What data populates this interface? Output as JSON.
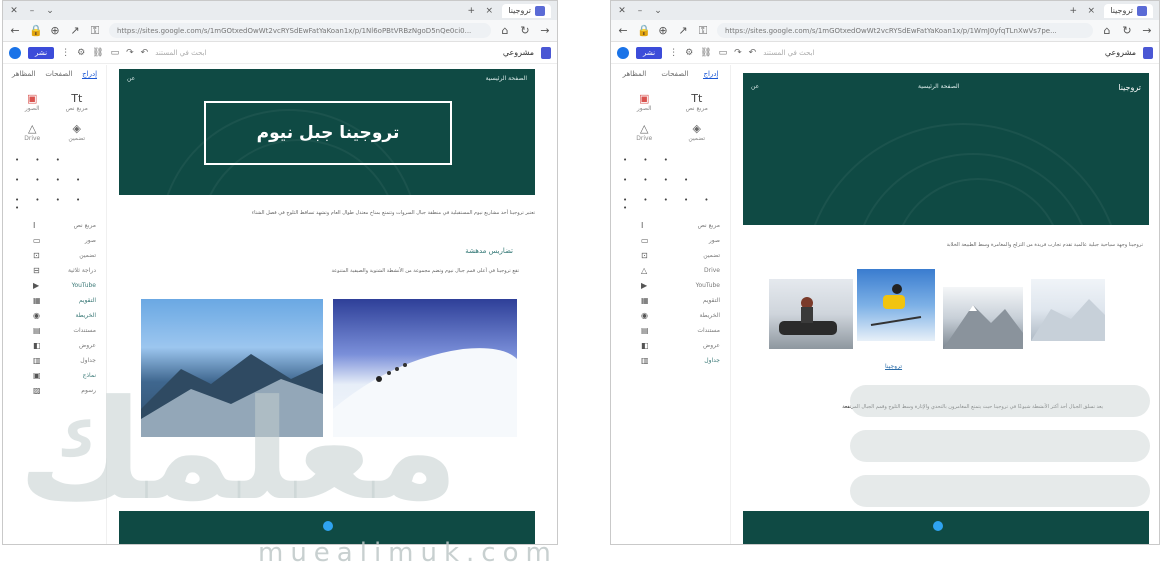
{
  "browser": {
    "tab_title": "تروجينا",
    "close_glyph": "×",
    "new_tab_glyph": "+",
    "url_host": "sites.google.com",
    "url_path_left": "https://sites.google.com/s/1mGOtxedOwWt2vcRYSdEwFatYaKoan1x/p/1Nl6oPBtVRBzNgoD5nQe0ci0...",
    "url_path_right": "https://sites.google.com/s/1mGOtxedOwWt2vcRYSdEwFatYaKoan1x/p/1WmJ0yfqTLnXwVs7pe..."
  },
  "editor": {
    "publish_label": "نشر",
    "site_name": "مشروعي",
    "search_placeholder": "ابحث في المستند"
  },
  "panel": {
    "tabs": [
      "إدراج",
      "الصفحات",
      "المظاهر"
    ],
    "inserts": [
      {
        "label": "مربع نص",
        "glyph": "Tt"
      },
      {
        "label": "الصور",
        "glyph": "▣"
      },
      {
        "label": "تضمين",
        "glyph": "◈"
      },
      {
        "label": "Drive",
        "glyph": "△"
      }
    ],
    "rows_left": [
      "مربع نص",
      "صور",
      "تضمين",
      "دراجة ثلاثية",
      "YouTube",
      "التقويم",
      "الخريطة",
      "مستندات",
      "عروض",
      "جداول",
      "نماذج",
      "رسوم"
    ],
    "rows_right": [
      "مربع نص",
      "صور",
      "تضمين",
      "Drive",
      "YouTube",
      "التقويم",
      "الخريطة",
      "مستندات",
      "عروض",
      "جداول"
    ]
  },
  "left_page": {
    "nav_title": "الصفحة الرئيسية",
    "nav_link": "عن",
    "hero_title": "تروجينا جبل نيوم",
    "intro": "تعتبر تروجينا أحد مشاريع نيوم المستقبلية في منطقة جبال السروات وتتمتع بمناخ معتدل طوال العام وتشهد تساقط الثلوج في فصل الشتاء",
    "subheading": "تضاريس مدهشة",
    "sub_text": "تقع تروجينا في أعلى قمم جبال نيوم وتضم مجموعة من الأنشطة الشتوية والصيفية المتنوعة",
    "images": [
      "mountain",
      "snow-climbers"
    ]
  },
  "right_page": {
    "site_title": "تروجينا",
    "nav_title": "الصفحة الرئيسية",
    "nav_link": "عن",
    "intro": "تروجينا وجهة سياحية جبلية عالمية تقدم تجارب فريدة من التزلج والمغامرة وسط الطبيعة الخلابة",
    "image_caption": "تروجينا",
    "bottom_text": "يعد تسلق الجبال أحد أكثر الأنشطة شيوعًا في تروجينا حيث يتمتع المغامرون بالتحدي والإثارة وسط الثلوج وقمم الجبال المرتفعة",
    "images": [
      "snowmobile",
      "skier",
      "peak",
      "peak-2"
    ]
  },
  "watermark": {
    "arabic": "معلمك",
    "latin": "muealimuk.com"
  }
}
